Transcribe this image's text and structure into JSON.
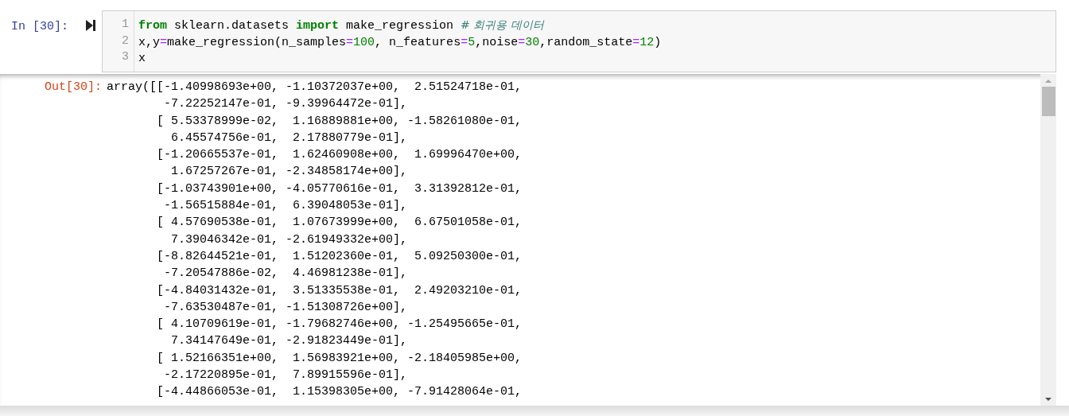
{
  "input_cell": {
    "prompt": "In [30]:",
    "code_lines": [
      [
        {
          "kind": "keyword",
          "text": "from"
        },
        {
          "kind": "plain",
          "text": " sklearn.datasets "
        },
        {
          "kind": "keyword",
          "text": "import"
        },
        {
          "kind": "plain",
          "text": " make_regression "
        },
        {
          "kind": "comment",
          "text": "# 회귀용 데이터"
        }
      ],
      [
        {
          "kind": "plain",
          "text": "x,y"
        },
        {
          "kind": "operator",
          "text": "="
        },
        {
          "kind": "plain",
          "text": "make_regression(n_samples"
        },
        {
          "kind": "operator",
          "text": "="
        },
        {
          "kind": "number",
          "text": "100"
        },
        {
          "kind": "plain",
          "text": ", n_features"
        },
        {
          "kind": "operator",
          "text": "="
        },
        {
          "kind": "number",
          "text": "5"
        },
        {
          "kind": "plain",
          "text": ",noise"
        },
        {
          "kind": "operator",
          "text": "="
        },
        {
          "kind": "number",
          "text": "30"
        },
        {
          "kind": "plain",
          "text": ",random_state"
        },
        {
          "kind": "operator",
          "text": "="
        },
        {
          "kind": "number",
          "text": "12"
        },
        {
          "kind": "plain",
          "text": ")"
        }
      ],
      [
        {
          "kind": "plain",
          "text": "x"
        }
      ]
    ],
    "line_numbers": [
      "1",
      "2",
      "3"
    ]
  },
  "output_cell": {
    "prompt": "Out[30]:",
    "lines": [
      "array([[-1.40998693e+00, -1.10372037e+00,  2.51524718e-01,",
      "        -7.22252147e-01, -9.39964472e-01],",
      "       [ 5.53378999e-02,  1.16889881e+00, -1.58261080e-01,",
      "         6.45574756e-01,  2.17880779e-01],",
      "       [-1.20665537e-01,  1.62460908e+00,  1.69996470e+00,",
      "         1.67257267e-01, -2.34858174e+00],",
      "       [-1.03743901e+00, -4.05770616e-01,  3.31392812e-01,",
      "        -1.56515884e-01,  6.39048053e-01],",
      "       [ 4.57690538e-01,  1.07673999e+00,  6.67501058e-01,",
      "         7.39046342e-01, -2.61949332e+00],",
      "       [-8.82644521e-01,  1.51202360e-01,  5.09250300e-01,",
      "        -7.20547886e-02,  4.46981238e-01],",
      "       [-4.84031432e-01,  3.51335538e-01,  2.49203210e-01,",
      "        -7.63530487e-01, -1.51308726e+00],",
      "       [ 4.10709619e-01, -1.79682746e+00, -1.25495665e-01,",
      "         7.34147649e-01, -2.91823449e-01],",
      "       [ 1.52166351e+00,  1.56983921e+00, -2.18405985e+00,",
      "        -2.17220895e-01,  7.89915596e-01],",
      "       [-4.44866053e-01,  1.15398305e+00, -7.91428064e-01,"
    ]
  }
}
